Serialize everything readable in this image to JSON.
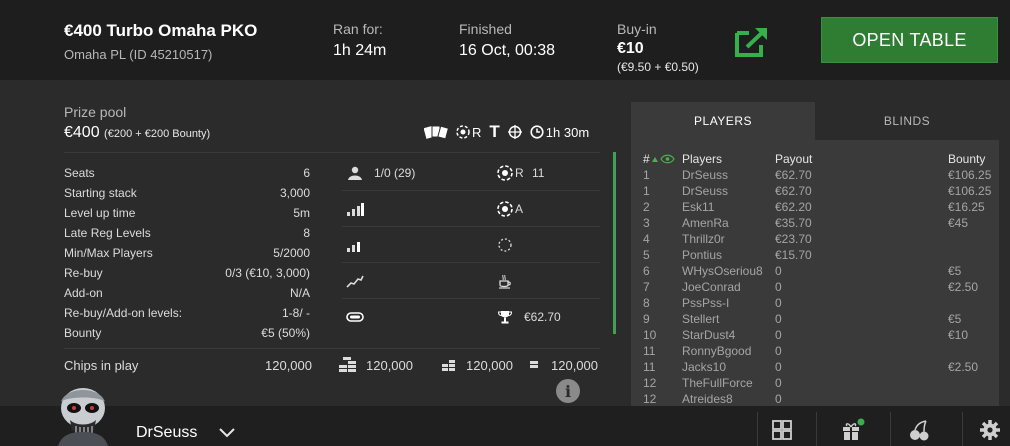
{
  "header": {
    "title": "€400 Turbo Omaha PKO",
    "subtitle": "Omaha PL (ID 45210517)",
    "ran_for_label": "Ran for:",
    "ran_for_value": "1h 24m",
    "finished_label": "Finished",
    "finished_value": "16 Oct, 00:38",
    "buyin_label": "Buy-in",
    "buyin_value": "€10",
    "buyin_breakdown": "(€9.50 + €0.50)",
    "open_table_label": "OPEN TABLE"
  },
  "prize": {
    "label": "Prize pool",
    "value": "€400",
    "breakdown": "(€200 + €200 Bounty)"
  },
  "badges": {
    "rebuy_letter": "R",
    "type_letter": "T",
    "duration": "1h 30m"
  },
  "settings": [
    {
      "label": "Seats",
      "value": "6"
    },
    {
      "label": "Starting stack",
      "value": "3,000"
    },
    {
      "label": "Level up time",
      "value": "5m"
    },
    {
      "label": "Late Reg Levels",
      "value": "8"
    },
    {
      "label": "Min/Max Players",
      "value": "5/2000"
    },
    {
      "label": "Re-buy",
      "value": "0/3 (€10, 3,000)"
    },
    {
      "label": "Add-on",
      "value": "N/A"
    },
    {
      "label": "Re-buy/Add-on levels:",
      "value": "1-8/ -"
    },
    {
      "label": "Bounty",
      "value": "€5 (50%)"
    }
  ],
  "info_grid": {
    "players_count": "1/0 (29)",
    "rebuy_count_letter": "R",
    "rebuy_count": "11",
    "addon_letter": "A",
    "prize_won": "€62.70"
  },
  "chips": {
    "label": "Chips in play",
    "value": "120,000",
    "largest": "120,000",
    "average": "120,000",
    "smallest": "120,000"
  },
  "panel": {
    "tab_players": "PLAYERS",
    "tab_blinds": "BLINDS",
    "headers": {
      "rank": "#",
      "players": "Players",
      "payout": "Payout",
      "bounty": "Bounty"
    },
    "rows": [
      {
        "rank": "1",
        "name": "DrSeuss",
        "payout": "€62.70",
        "bounty": "€106.25"
      },
      {
        "rank": "1",
        "name": "DrSeuss",
        "payout": "€62.70",
        "bounty": "€106.25"
      },
      {
        "rank": "2",
        "name": "Esk11",
        "payout": "€62.20",
        "bounty": "€16.25"
      },
      {
        "rank": "3",
        "name": "AmenRa",
        "payout": "€35.70",
        "bounty": "€45"
      },
      {
        "rank": "4",
        "name": "Thrillz0r",
        "payout": "€23.70",
        "bounty": ""
      },
      {
        "rank": "5",
        "name": "Pontius",
        "payout": "€15.70",
        "bounty": ""
      },
      {
        "rank": "6",
        "name": "WHysOseriou8",
        "payout": "0",
        "bounty": "€5"
      },
      {
        "rank": "7",
        "name": "JoeConrad",
        "payout": "0",
        "bounty": "€2.50"
      },
      {
        "rank": "8",
        "name": "PssPss-I",
        "payout": "0",
        "bounty": ""
      },
      {
        "rank": "9",
        "name": "Stellert",
        "payout": "0",
        "bounty": "€5"
      },
      {
        "rank": "10",
        "name": "StarDust4",
        "payout": "0",
        "bounty": "€10"
      },
      {
        "rank": "11",
        "name": "RonnyBgood",
        "payout": "0",
        "bounty": ""
      },
      {
        "rank": "11",
        "name": "Jacks10",
        "payout": "0",
        "bounty": "€2.50"
      },
      {
        "rank": "12",
        "name": "TheFullForce",
        "payout": "0",
        "bounty": ""
      },
      {
        "rank": "12",
        "name": "Atreides8",
        "payout": "0",
        "bounty": ""
      }
    ]
  },
  "bottom": {
    "username": "DrSeuss"
  },
  "colors": {
    "accent_green": "#2e7d32",
    "scroll_green": "#3fa34d",
    "background": "#2b2b2b",
    "header_bg": "#1e1e1e"
  },
  "icons": {
    "external": "external-link-icon",
    "cards": "cards-icon",
    "chip": "chip-icon",
    "target": "target-icon",
    "clock": "clock-icon",
    "info": "info-icon"
  }
}
